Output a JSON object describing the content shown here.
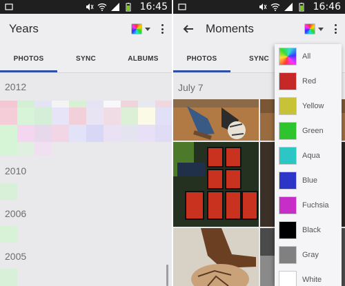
{
  "left_screen": {
    "status_time": "16:45",
    "title": "Years",
    "tabs": [
      {
        "label": "PHOTOS",
        "selected": true
      },
      {
        "label": "SYNC",
        "selected": false
      },
      {
        "label": "ALBUMS",
        "selected": false
      }
    ],
    "sections": [
      {
        "year": "2012"
      },
      {
        "year": "2010"
      },
      {
        "year": "2006"
      },
      {
        "year": "2005"
      }
    ]
  },
  "right_screen": {
    "status_time": "16:46",
    "title": "Moments",
    "tabs": [
      {
        "label": "PHOTOS",
        "selected": true
      },
      {
        "label": "SYNC",
        "selected": false
      }
    ],
    "section_date": "July 7"
  },
  "color_menu": {
    "items": [
      {
        "label": "All",
        "color": "rainbow"
      },
      {
        "label": "Red",
        "color": "#c62828"
      },
      {
        "label": "Yellow",
        "color": "#c8c237"
      },
      {
        "label": "Green",
        "color": "#2ec42e"
      },
      {
        "label": "Aqua",
        "color": "#2ec6c4"
      },
      {
        "label": "Blue",
        "color": "#2b36c8"
      },
      {
        "label": "Fuchsia",
        "color": "#c72ec7"
      },
      {
        "label": "Black",
        "color": "#000000"
      },
      {
        "label": "Gray",
        "color": "#808080"
      },
      {
        "label": "White",
        "color": "#ffffff"
      }
    ]
  },
  "icons": {
    "back": "arrow-left-icon",
    "palette": "color-palette-icon",
    "overflow": "more-vert-icon",
    "wifi": "wifi-icon",
    "signal": "signal-icon",
    "battery": "battery-icon",
    "mute": "mute-icon"
  },
  "colors": {
    "accent": "#2f4fa6",
    "status_bar": "#1f1f1f",
    "background": "#e9e9ec"
  }
}
